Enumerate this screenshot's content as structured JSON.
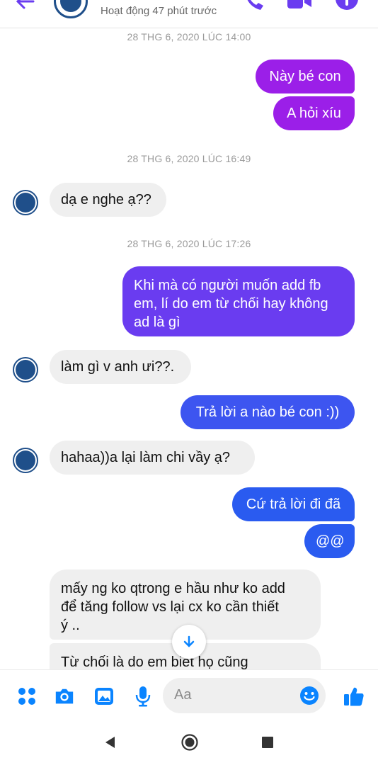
{
  "header": {
    "status": "Hoạt động 47 phút trước",
    "icons": [
      "back-arrow-icon",
      "phone-icon",
      "video-icon",
      "info-icon"
    ]
  },
  "messages": {
    "ts1": "28 THG 6, 2020 LÚC 14:00",
    "m1": "Này bé con",
    "m2": "A hỏi xíu",
    "ts2": "28 THG 6, 2020 LÚC 16:49",
    "m3": "dạ e nghe ạ??",
    "ts3": "28 THG 6, 2020 LÚC 17:26",
    "m4_line1": "Khi mà có người muốn add fb",
    "m4_line2": "em, lí do em từ chối hay không",
    "m4_line3": "ad là gì",
    "m5": "làm gì v anh ưi??.",
    "m6": "Trả lời a nào bé con :))",
    "m7": "hahaa))a lại làm chi vầy ạ?",
    "m8": "Cứ trả lời đi đã",
    "m9": "@@",
    "m10_line1": "mấy ng ko qtrong e hầu như ko add",
    "m10_line2": "để tăng follow vs lại cx ko cần thiết",
    "m10_line3": "ý ..",
    "m11": "Từ chối là do em biết họ cũng"
  },
  "composer": {
    "placeholder": "Aa"
  },
  "colors": {
    "bubble_purple": "#9b1fe8",
    "bubble_violet": "#6a3cf0",
    "bubble_blue": "#2a5bf0",
    "accent": "#0a84ff"
  }
}
